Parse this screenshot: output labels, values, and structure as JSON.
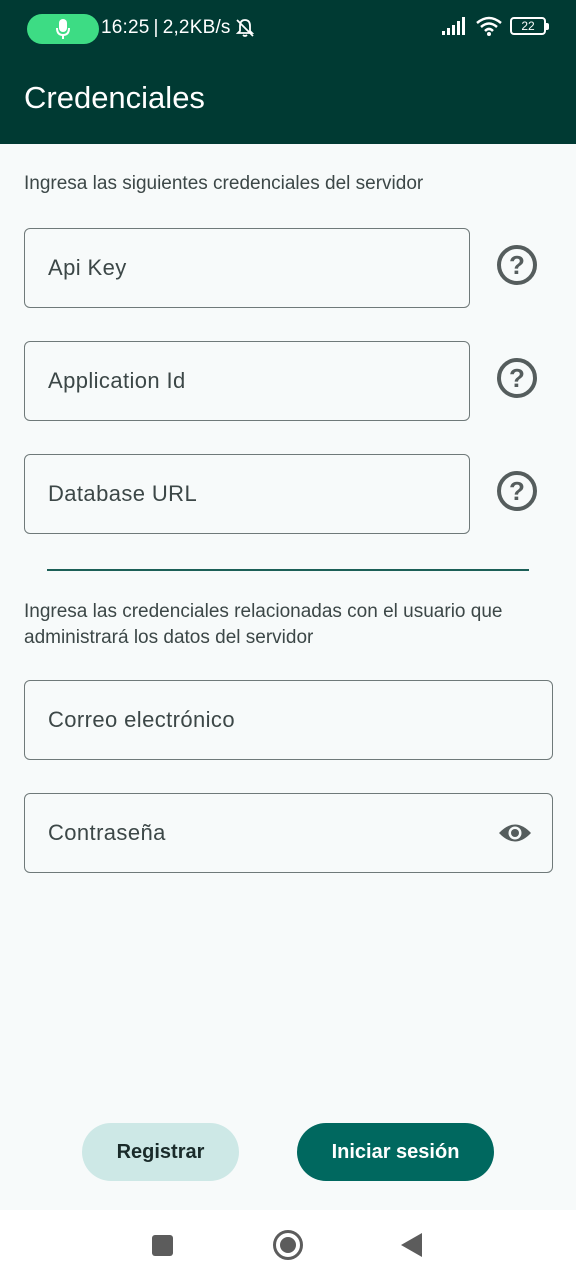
{
  "status_bar": {
    "time": "16:25",
    "separator": "|",
    "network_speed": "2,2KB/s",
    "battery_level": "22",
    "icons": [
      "mic-icon",
      "bell-off-icon",
      "signal-icon",
      "wifi-icon",
      "battery-icon"
    ]
  },
  "app_bar": {
    "title": "Credenciales"
  },
  "server_section": {
    "intro": "Ingresa las siguientes credenciales del servidor",
    "fields": [
      {
        "label": "Api Key",
        "help_icon": "?"
      },
      {
        "label": "Application Id",
        "help_icon": "?"
      },
      {
        "label": "Database URL",
        "help_icon": "?"
      }
    ]
  },
  "user_section": {
    "intro_line1": "Ingresa las credenciales relacionadas con el usuario que",
    "intro_line2": "administrará los datos del servidor",
    "email_label": "Correo electrónico",
    "password_label": "Contraseña"
  },
  "buttons": {
    "register": "Registrar",
    "login": "Iniciar sesión"
  },
  "colors": {
    "app_bar": "#003a33",
    "primary": "#00685f",
    "secondary_button": "#cde8e6",
    "mic_pill": "#3ddc84"
  }
}
